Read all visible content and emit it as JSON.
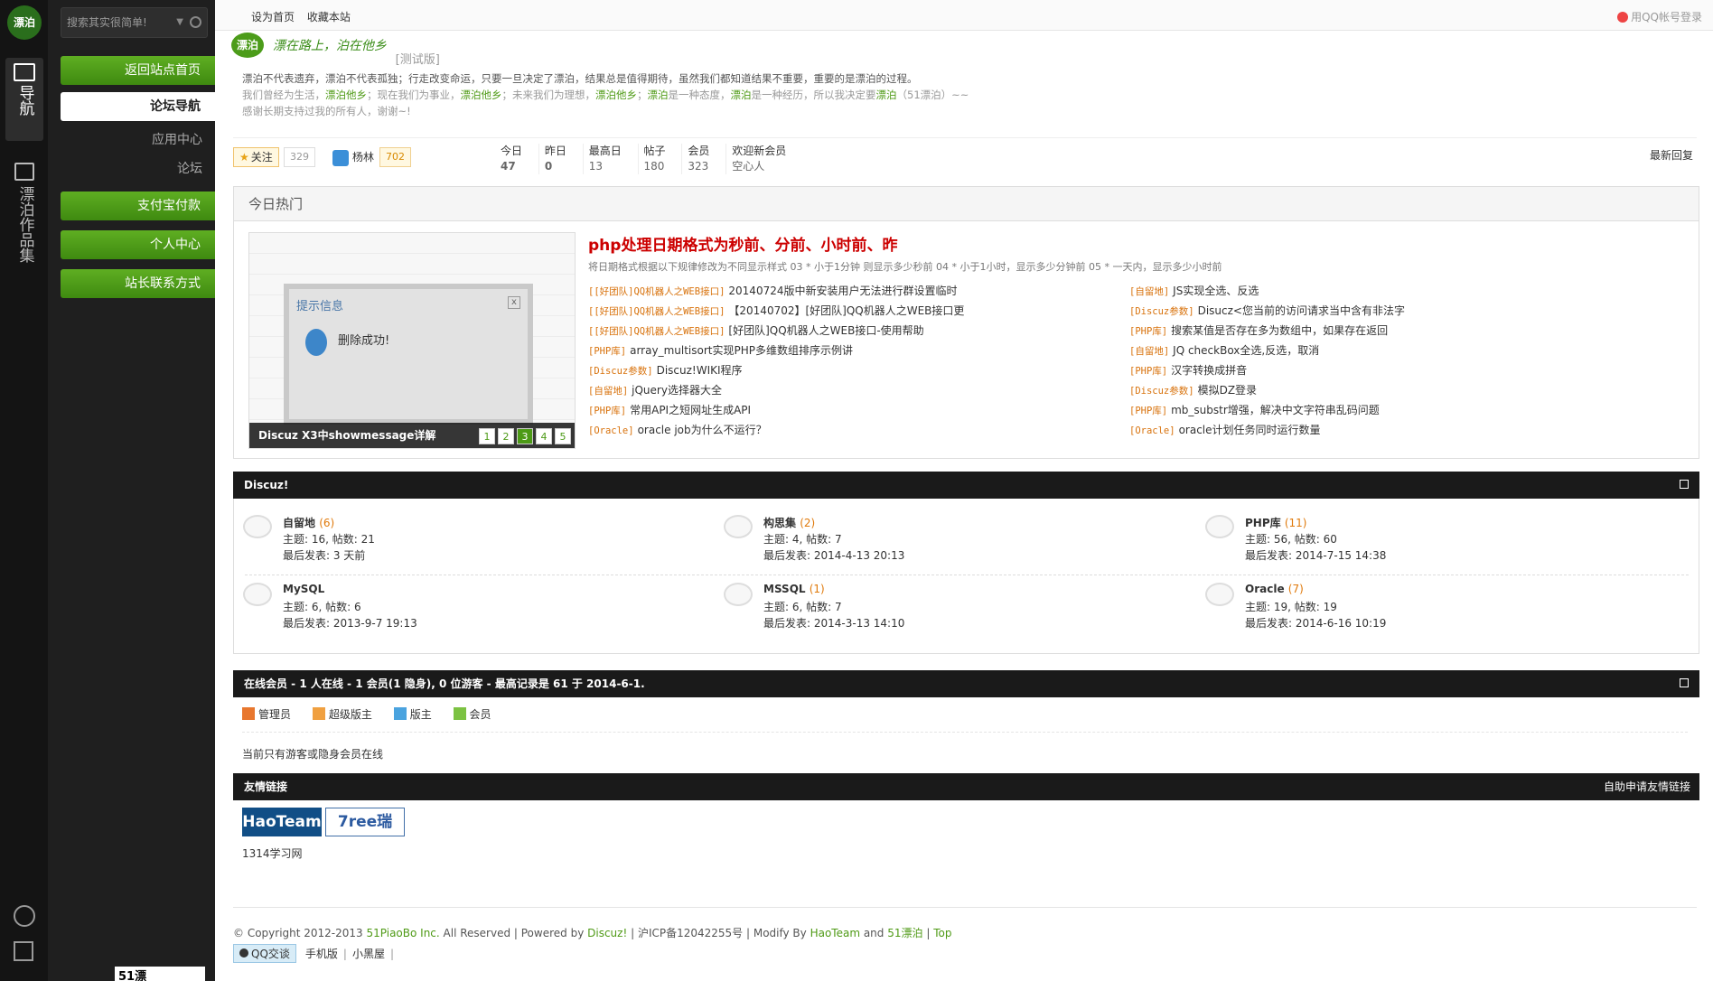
{
  "rail": {
    "logo_text": "漂泊",
    "nav_label": "导航",
    "works_label": "漂泊作品集"
  },
  "sidebar": {
    "search_placeholder": "搜索其实很简单!",
    "buttons": [
      "返回站点首页",
      "论坛导航",
      "应用中心",
      "论坛",
      "支付宝付款",
      "个人中心",
      "站长联系方式"
    ],
    "mini_logo": "51漂"
  },
  "topbar": {
    "set_home": "设为首页",
    "bookmark": "收藏本站",
    "qq_login": "用QQ帐号登录"
  },
  "brand": {
    "mark": "漂泊",
    "slogan": "漂在路上，泊在他乡",
    "beta": "[测试版]"
  },
  "intro": {
    "line1": "漂泊不代表遗弃，漂泊不代表孤独；行走改变命运，只要一旦决定了漂泊，结果总是值得期待，虽然我们都知道结果不重要，重要的是漂泊的过程。",
    "line2_a": "我们曾经为生活，",
    "line2_g1": "漂泊他乡",
    "line2_b": "；现在我们为事业，",
    "line2_g2": "漂泊他乡",
    "line2_c": "；未来我们为理想，",
    "line2_g3": "漂泊他乡",
    "line2_d": "；",
    "line2_g4": "漂泊",
    "line2_e": "是一种态度，",
    "line2_g5": "漂泊",
    "line2_f": "是一种经历，所以我决定要",
    "line2_g6": "漂泊",
    "line2_h": "（51漂泊）~~",
    "line3": "感谢长期支持过我的所有人，谢谢~!"
  },
  "stats": {
    "follow_label": "关注",
    "follow_count": "329",
    "user_name": "杨林",
    "user_count": "702",
    "items": [
      {
        "label": "今日",
        "value": "47",
        "bold": true
      },
      {
        "label": "昨日",
        "value": "0",
        "bold": true
      },
      {
        "label": "最高日",
        "value": "13",
        "bold": false
      },
      {
        "label": "帖子",
        "value": "180",
        "bold": false
      },
      {
        "label": "会员",
        "value": "323",
        "bold": false
      },
      {
        "label": "欢迎新会员",
        "value": "空心人",
        "bold": false
      }
    ],
    "latest_reply": "最新回复"
  },
  "hot": {
    "title": "今日热门",
    "slide": {
      "dialog_title": "提示信息",
      "dialog_msg": "删除成功!",
      "dialog_close": "x",
      "caption": "Discuz X3中showmessage详解",
      "pages": [
        "1",
        "2",
        "3",
        "4",
        "5"
      ],
      "active_page": "3"
    },
    "headline": "php处理日期格式为秒前、分前、小时前、昨",
    "summary": "将日期格式根据以下规律修改为不同显示样式 03 * 小于1分钟 则显示多少秒前 04 * 小于1小时，显示多少分钟前 05 * 一天内，显示多少小时前",
    "left": [
      {
        "tag": "[[好团队]QQ机器人之WEB接口]",
        "title": "20140724版中新安装用户无法进行群设置临时"
      },
      {
        "tag": "[[好团队]QQ机器人之WEB接口]",
        "title": "【20140702】[好团队]QQ机器人之WEB接口更"
      },
      {
        "tag": "[[好团队]QQ机器人之WEB接口]",
        "title": "[好团队]QQ机器人之WEB接口-使用帮助"
      },
      {
        "tag": "[PHP库]",
        "title": "array_multisort实现PHP多维数组排序示例讲"
      },
      {
        "tag": "[Discuz参数]",
        "title": "Discuz!WIKI程序"
      },
      {
        "tag": "[自留地]",
        "title": "jQuery选择器大全"
      },
      {
        "tag": "[PHP库]",
        "title": "常用API之短网址生成API"
      },
      {
        "tag": "[Oracle]",
        "title": "oracle job为什么不运行？"
      }
    ],
    "right": [
      {
        "tag": "[自留地]",
        "title": "JS实现全选、反选"
      },
      {
        "tag": "[Discuz参数]",
        "title": "Disucz<您当前的访问请求当中含有非法字"
      },
      {
        "tag": "[PHP库]",
        "title": "搜索某值是否存在多为数组中，如果存在返回"
      },
      {
        "tag": "[自留地]",
        "title": "JQ checkBox全选,反选，取消"
      },
      {
        "tag": "[PHP库]",
        "title": "汉字转换成拼音"
      },
      {
        "tag": "[Discuz参数]",
        "title": "模拟DZ登录"
      },
      {
        "tag": "[PHP库]",
        "title": "mb_substr增强，解决中文字符串乱码问题"
      },
      {
        "tag": "[Oracle]",
        "title": "oracle计划任务同时运行数量"
      }
    ]
  },
  "discuz": {
    "title": "Discuz!",
    "forums": [
      {
        "name": "自留地",
        "count": "(6)",
        "stats": "主题: 16, 帖数: 21",
        "last": "最后发表: 3 天前"
      },
      {
        "name": "构思集",
        "count": "(2)",
        "stats": "主题: 4, 帖数: 7",
        "last": "最后发表: 2014-4-13 20:13"
      },
      {
        "name": "PHP库",
        "count": "(11)",
        "stats": "主题: 56, 帖数: 60",
        "last": "最后发表: 2014-7-15 14:38"
      },
      {
        "name": "MySQL",
        "count": "",
        "stats": "主题: 6, 帖数: 6",
        "last": "最后发表: 2013-9-7 19:13"
      },
      {
        "name": "MSSQL",
        "count": "(1)",
        "stats": "主题: 6, 帖数: 7",
        "last": "最后发表: 2014-3-13 14:10"
      },
      {
        "name": "Oracle",
        "count": "(7)",
        "stats": "主题: 19, 帖数: 19",
        "last": "最后发表: 2014-6-16 10:19"
      }
    ]
  },
  "online": {
    "title": "在线会员 - 1 人在线 - 1 会员(1 隐身), 0 位游客 - 最高记录是 61 于 2014-6-1.",
    "legend": [
      "管理员",
      "超级版主",
      "版主",
      "会员"
    ],
    "legend_colors": [
      "#e8772e",
      "#f0a040",
      "#4aa3df",
      "#7cc242"
    ],
    "status": "当前只有游客或隐身会员在线"
  },
  "links": {
    "title": "友情链接",
    "apply": "自助申请友情链接",
    "logo1": "HaoTeam",
    "logo2": "7ree瑞",
    "text_link": "1314学习网"
  },
  "footer": {
    "copy_a": "© Copyright 2012-2013 ",
    "copy_g1": "51PiaoBo Inc.",
    "copy_b": " All Reserved | Powered by ",
    "copy_g2": "Discuz!",
    "copy_c": " | 沪ICP备12042255号 | Modify By ",
    "copy_g3": "HaoTeam",
    "copy_d": " and ",
    "copy_g4": "51漂泊",
    "copy_e": " | ",
    "copy_g5": "Top",
    "qq": "QQ交谈",
    "mobile": "手机版",
    "blackroom": "小黑屋"
  }
}
